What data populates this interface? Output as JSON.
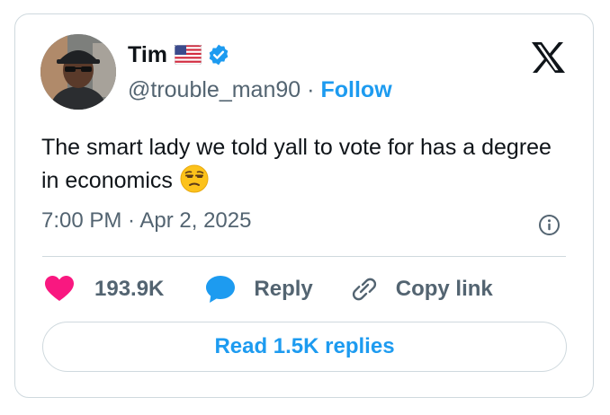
{
  "author": {
    "display_name": "Tim",
    "handle": "@trouble_man90",
    "separator": "·",
    "follow_label": "Follow"
  },
  "tweet": {
    "text": "The smart lady we told yall to vote for has a degree in economics",
    "emoji": "unamused-face",
    "timestamp": "7:00 PM · Apr 2, 2025"
  },
  "actions": {
    "likes": "193.9K",
    "reply_label": "Reply",
    "copy_label": "Copy link"
  },
  "read_replies_label": "Read 1.5K replies",
  "icons": {
    "flag": "us-flag-icon",
    "verified": "verified-badge-icon",
    "logo": "x-logo-icon",
    "info": "info-icon",
    "like": "heart-icon",
    "reply": "reply-bubble-icon",
    "copy": "link-icon"
  },
  "colors": {
    "accent": "#1d9bf0",
    "like": "#f91880",
    "text": "#0f1419",
    "muted": "#536471",
    "border": "#cfd9de"
  }
}
